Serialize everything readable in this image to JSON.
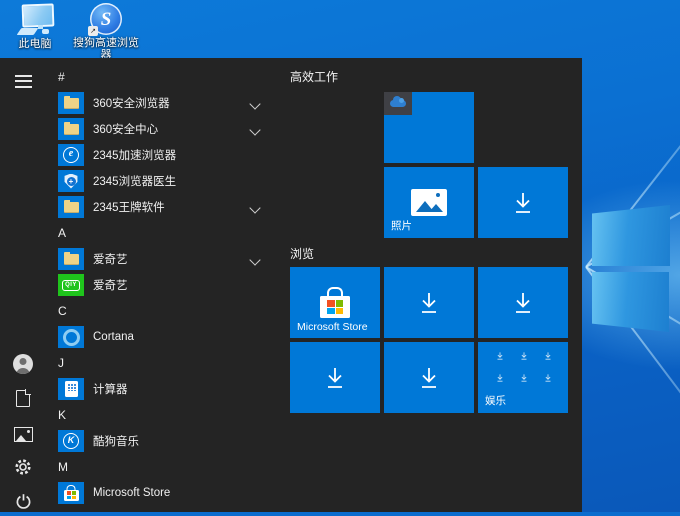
{
  "colors": {
    "accent": "#0078d7",
    "menu_bg": "#242424",
    "tile_blue": "#0078d7",
    "wallpaper_blue": "#0b6cce",
    "iqiyi_green": "#1fc41c",
    "folder_yellow": "#eed387"
  },
  "desktop": {
    "icons": [
      {
        "label": "此电脑",
        "icon": "this-pc-icon"
      },
      {
        "label": "搜狗高速浏览器",
        "icon": "sogou-browser-icon",
        "shortcut": true
      }
    ]
  },
  "start_menu": {
    "rail": {
      "icons": [
        "menu",
        "user",
        "documents",
        "pictures",
        "settings",
        "power"
      ]
    },
    "app_list": {
      "rows": [
        {
          "type": "header",
          "label": "#"
        },
        {
          "type": "app",
          "label": "360安全浏览器",
          "icon": "folder-icon",
          "expandable": true
        },
        {
          "type": "app",
          "label": "360安全中心",
          "icon": "folder-icon",
          "expandable": true
        },
        {
          "type": "app",
          "label": "2345加速浏览器",
          "icon": "browser-e-icon",
          "expandable": false
        },
        {
          "type": "app",
          "label": "2345浏览器医生",
          "icon": "shield-plus-icon",
          "expandable": false
        },
        {
          "type": "app",
          "label": "2345王牌软件",
          "icon": "folder-icon",
          "expandable": true
        },
        {
          "type": "header",
          "label": "A"
        },
        {
          "type": "app",
          "label": "爱奇艺",
          "icon": "folder-icon",
          "expandable": true
        },
        {
          "type": "app",
          "label": "爱奇艺",
          "icon": "iqiyi-icon",
          "expandable": false
        },
        {
          "type": "header",
          "label": "C"
        },
        {
          "type": "app",
          "label": "Cortana",
          "icon": "cortana-icon",
          "expandable": false
        },
        {
          "type": "header",
          "label": "J"
        },
        {
          "type": "app",
          "label": "计算器",
          "icon": "calculator-icon",
          "expandable": false
        },
        {
          "type": "header",
          "label": "K"
        },
        {
          "type": "app",
          "label": "酷狗音乐",
          "icon": "kugou-icon",
          "expandable": false
        },
        {
          "type": "header",
          "label": "M"
        },
        {
          "type": "app",
          "label": "Microsoft Store",
          "icon": "store-icon",
          "expandable": false
        }
      ]
    },
    "tile_groups": [
      {
        "title": "高效工作",
        "tiles": [
          {
            "name": "onedrive",
            "label": "",
            "icon": "onedrive-cloud-icon"
          },
          {
            "name": "photos",
            "label": "照片",
            "icon": "photos-icon"
          },
          {
            "name": "download",
            "label": "",
            "icon": "download-arrow-icon"
          }
        ]
      },
      {
        "title": "浏览",
        "tiles": [
          {
            "name": "microsoft-store",
            "label": "Microsoft Store",
            "icon": "store-bag-icon"
          },
          {
            "name": "download",
            "label": "",
            "icon": "download-arrow-icon"
          },
          {
            "name": "download",
            "label": "",
            "icon": "download-arrow-icon"
          },
          {
            "name": "download",
            "label": "",
            "icon": "download-arrow-icon"
          },
          {
            "name": "download",
            "label": "",
            "icon": "download-arrow-icon"
          },
          {
            "name": "entertainment-folder",
            "label": "娱乐",
            "icon": "download-arrow-icons"
          }
        ]
      }
    ]
  }
}
